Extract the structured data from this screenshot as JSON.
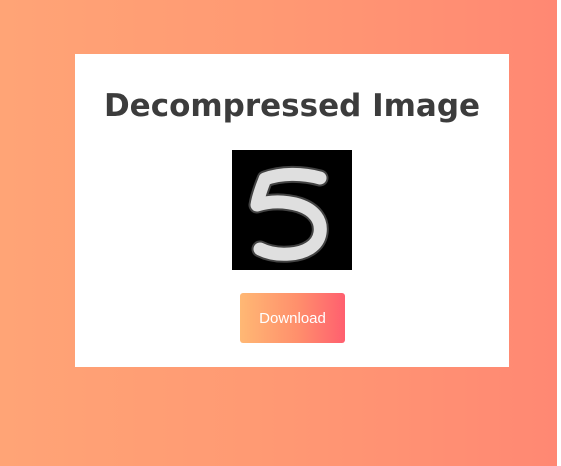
{
  "page": {
    "title": "Decompressed Image",
    "image_alt_icon": "digit-5-image",
    "download_label": "Download"
  },
  "colors": {
    "background_left": "#ffa476",
    "background_right": "#ff8873",
    "card": "#ffffff",
    "title": "#3c3c3c",
    "button_left": "#ffb874",
    "button_right": "#ff5f6f"
  }
}
